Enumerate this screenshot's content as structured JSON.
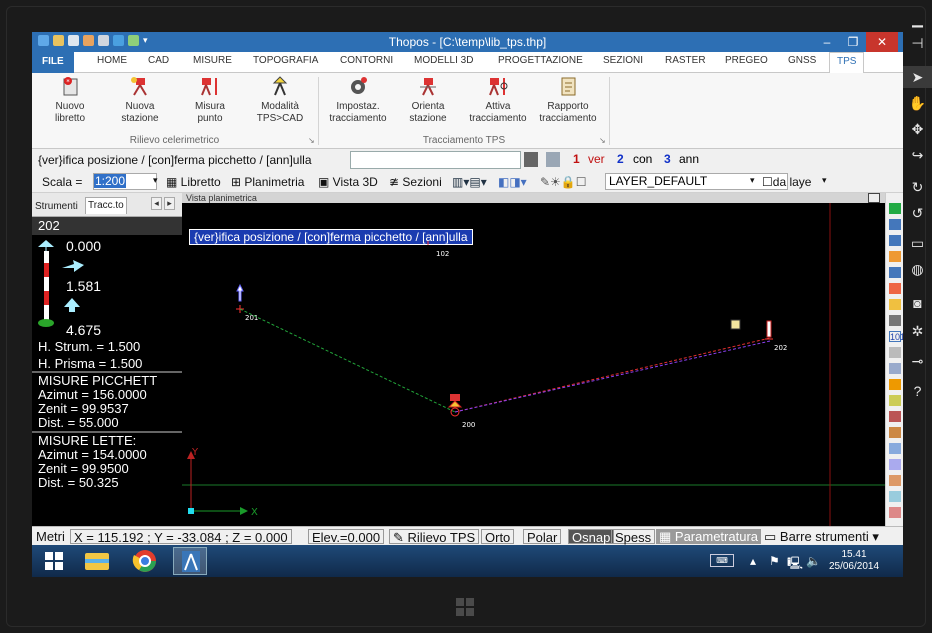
{
  "window": {
    "title": "Thopos - [C:\\temp\\lib_tps.thp]",
    "minimize": "–",
    "restore": "❐",
    "close": "✕"
  },
  "ribbon_tabs": [
    "FILE",
    "HOME",
    "CAD",
    "MISURE",
    "TOPOGRAFIA",
    "CONTORNI",
    "MODELLI 3D",
    "PROGETTAZIONE",
    "SEZIONI",
    "RASTER",
    "PREGEO",
    "GNSS",
    "TPS"
  ],
  "active_tab": "TPS",
  "ribbon": {
    "group1": {
      "label": "Rilievo celerimetrico",
      "buttons": [
        {
          "l1": "Nuovo",
          "l2": "libretto",
          "icon": "new-book-icon"
        },
        {
          "l1": "Nuova",
          "l2": "stazione",
          "icon": "new-station-icon"
        },
        {
          "l1": "Misura",
          "l2": "punto",
          "icon": "measure-point-icon"
        },
        {
          "l1": "Modalità",
          "l2": "TPS>CAD",
          "icon": "tps-cad-mode-icon"
        }
      ]
    },
    "group2": {
      "label": "Tracciamento TPS",
      "buttons": [
        {
          "l1": "Impostaz.",
          "l2": "tracciamento",
          "icon": "settings-gear-icon"
        },
        {
          "l1": "Orienta",
          "l2": "stazione",
          "icon": "orient-station-icon"
        },
        {
          "l1": "Attiva",
          "l2": "tracciamento",
          "icon": "activate-staking-icon"
        },
        {
          "l1": "Rapporto",
          "l2": "tracciamento",
          "icon": "report-icon"
        }
      ]
    },
    "launcher": "↘"
  },
  "command": {
    "prompt": "{ver}ifica posizione / [con]ferma picchetto / [ann]ulla",
    "input_value": "",
    "options": [
      {
        "n": "1",
        "label": "ver"
      },
      {
        "n": "2",
        "label": "con"
      },
      {
        "n": "3",
        "label": "ann"
      }
    ]
  },
  "toolbar": {
    "scale_label": "Scala =",
    "scale_value": "1:200",
    "libretto": "Libretto",
    "planimetria": "Planimetria",
    "vista3d": "Vista 3D",
    "sezioni": "Sezioni",
    "layer": "LAYER_DEFAULT",
    "da_layer": "da laye"
  },
  "left_panel": {
    "tabs": [
      "Strumenti",
      "Tracc.to"
    ],
    "active_tab": "Tracc.to",
    "point": "202",
    "values": [
      "0.000",
      "1.581",
      "4.675"
    ],
    "h_strum": "H. Strum. = 1.500",
    "h_prisma": "H. Prisma = 1.500",
    "misure_picchetto": {
      "title": "MISURE PICCHETT",
      "azimut": "Azimut = 156.0000",
      "zenit": "Zenit = 99.9537",
      "dist": "Dist. = 55.000"
    },
    "misure_lette": {
      "title": "MISURE LETTE:",
      "azimut": "Azimut = 154.0000",
      "zenit": "Zenit = 99.9500",
      "dist": "Dist. = 50.325"
    }
  },
  "viewport": {
    "header": "Vista planimetrica",
    "prompt": "{ver}ifica posizione / [con]ferma picchetto / [ann]ulla",
    "points": [
      "102",
      "201",
      "200",
      "202"
    ],
    "axis_x": "X",
    "axis_y": "Y"
  },
  "status": {
    "units": "Metri",
    "coords": "X = 115.192 ; Y = -33.084 ; Z = 0.000",
    "elev": "Elev.=0.000",
    "rilievo": "Rilievo TPS",
    "orto": "Orto",
    "polar": "Polar",
    "osnap": "Osnap",
    "spess": "Spess",
    "parametratura": "Parametratura",
    "barre": "Barre strumenti"
  },
  "taskbar": {
    "time": "15.41",
    "date": "25/06/2014"
  },
  "colors": {
    "accent": "#2d6fb4",
    "close": "#c8352c",
    "green_line": "#22a43a",
    "red_line": "#e23030",
    "purple_line": "#8a3ff0"
  }
}
